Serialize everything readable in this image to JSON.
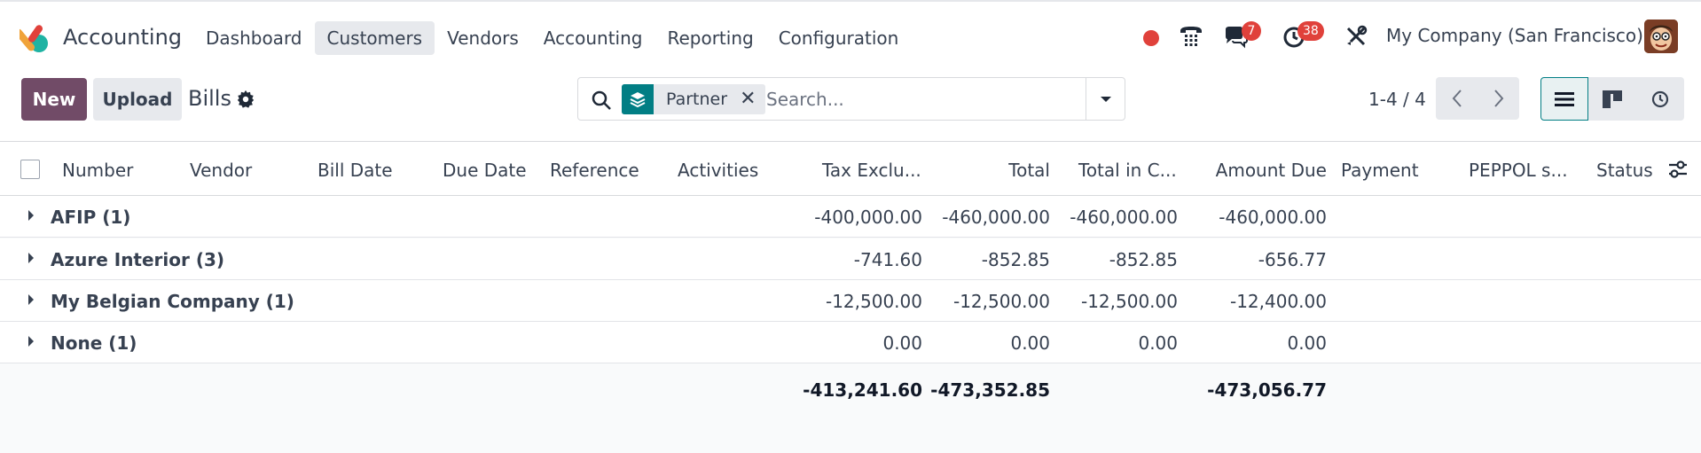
{
  "navbar": {
    "app_name": "Accounting",
    "menu": [
      "Dashboard",
      "Customers",
      "Vendors",
      "Accounting",
      "Reporting",
      "Configuration"
    ],
    "active_menu": "Customers",
    "messages_count": "7",
    "activities_count": "38",
    "company": "My Company (San Francisco)"
  },
  "control_panel": {
    "new_label": "New",
    "upload_label": "Upload",
    "breadcrumb": "Bills",
    "search": {
      "facet": "Partner",
      "placeholder": "Search..."
    },
    "pager": "1-4 / 4"
  },
  "table": {
    "columns": [
      "Number",
      "Vendor",
      "Bill Date",
      "Due Date",
      "Reference",
      "Activities",
      "Tax Exclu...",
      "Total",
      "Total in C...",
      "Amount Due",
      "Payment",
      "PEPPOL s...",
      "Status"
    ],
    "groups": [
      {
        "label": "AFIP (1)",
        "tax_excluded": "-400,000.00",
        "total": "-460,000.00",
        "total_currency": "-460,000.00",
        "amount_due": "-460,000.00"
      },
      {
        "label": "Azure Interior (3)",
        "tax_excluded": "-741.60",
        "total": "-852.85",
        "total_currency": "-852.85",
        "amount_due": "-656.77"
      },
      {
        "label": "My Belgian Company (1)",
        "tax_excluded": "-12,500.00",
        "total": "-12,500.00",
        "total_currency": "-12,500.00",
        "amount_due": "-12,400.00"
      },
      {
        "label": "None (1)",
        "tax_excluded": "0.00",
        "total": "0.00",
        "total_currency": "0.00",
        "amount_due": "0.00"
      }
    ],
    "totals": {
      "tax_excluded": "-413,241.60",
      "total": "-473,352.85",
      "amount_due": "-473,056.77"
    }
  },
  "colors": {
    "brand": "#714b67",
    "accent": "#017e84",
    "badge": "#e0413b"
  }
}
